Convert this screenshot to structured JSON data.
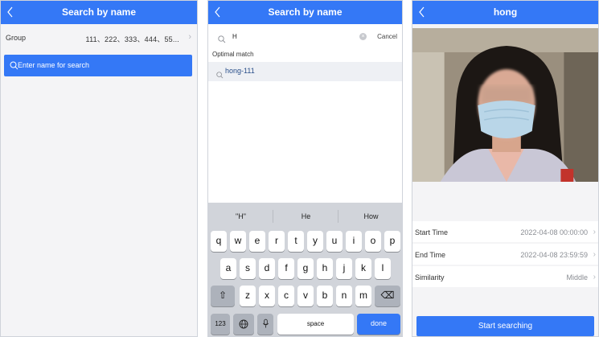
{
  "screen1": {
    "title": "Search by name",
    "group_label": "Group",
    "group_value": "111、222、333、444、55...",
    "search_placeholder": "Enter name for search"
  },
  "screen2": {
    "title": "Search by name",
    "search_query": "H",
    "cancel_label": "Cancel",
    "optimal_match_label": "Optimal match",
    "result_item": "hong-111",
    "keyboard": {
      "suggestions": [
        "\"H\"",
        "He",
        "How"
      ],
      "row1": [
        "q",
        "w",
        "e",
        "r",
        "t",
        "y",
        "u",
        "i",
        "o",
        "p"
      ],
      "row2": [
        "a",
        "s",
        "d",
        "f",
        "g",
        "h",
        "j",
        "k",
        "l"
      ],
      "row3": [
        "z",
        "x",
        "c",
        "v",
        "b",
        "n",
        "m"
      ],
      "numbers_key": "123",
      "space_key": "space",
      "done_key": "done"
    }
  },
  "screen3": {
    "title": "hong",
    "start_time_label": "Start Time",
    "start_time_value": "2022-04-08 00:00:00",
    "end_time_label": "End Time",
    "end_time_value": "2022-04-08 23:59:59",
    "similarity_label": "Similarity",
    "similarity_value": "Middle",
    "start_button": "Start searching"
  },
  "colors": {
    "accent": "#3478f6",
    "background": "#f4f4f6",
    "keyboard_bg": "#d1d4da"
  },
  "icons": [
    "chevron-left-icon",
    "search-icon",
    "clear-icon",
    "chevron-right-icon",
    "globe-icon",
    "microphone-icon",
    "shift-icon",
    "backspace-icon"
  ]
}
